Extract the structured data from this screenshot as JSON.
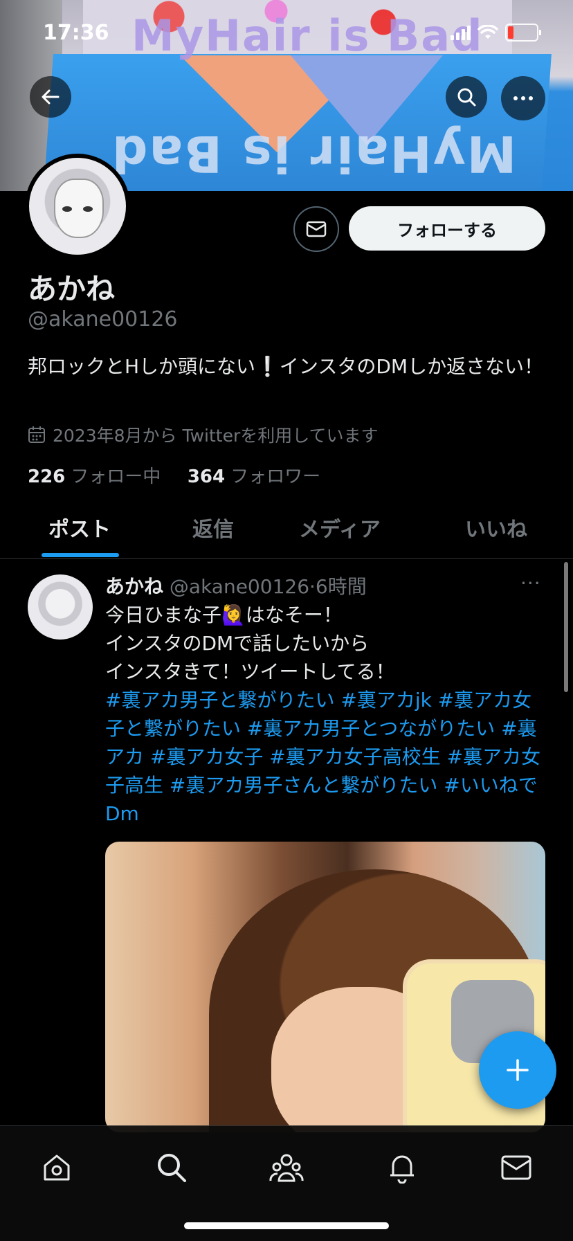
{
  "status_bar": {
    "time": "17:36"
  },
  "banner": {
    "brand_text_top": "MyHair is Bad",
    "brand_text_bottom": "MyHair is Bad"
  },
  "profile": {
    "name": "あかね",
    "handle": "@akane00126",
    "bio": "邦ロックとHしか頭にない❕インスタのDMしか返さない！",
    "joined": "2023年8月から Twitterを利用しています",
    "following_count": "226",
    "following_label": "フォロー中",
    "followers_count": "364",
    "followers_label": "フォロワー",
    "follow_button": "フォローする"
  },
  "tabs": [
    {
      "label": "ポスト",
      "active": true
    },
    {
      "label": "返信",
      "active": false
    },
    {
      "label": "メディア",
      "active": false
    },
    {
      "label": "いいね",
      "active": false
    }
  ],
  "tweet": {
    "name": "あかね",
    "handle": "@akane00126",
    "time": "6時間",
    "line1": "今日ひまな子🙋‍♀️はなそー！",
    "line2": "インスタのDMで話したいから",
    "line3": "インスタきて！ツイートしてる！",
    "hashtags": "#裏アカ男子と繋がりたい #裏アカjk #裏アカ女子と繋がりたい #裏アカ男子とつながりたい #裏アカ #裏アカ女子 #裏アカ女子高校生 #裏アカ女子高生 #裏アカ男子さんと繋がりたい #いいねでDm",
    "more": "···"
  },
  "colors": {
    "accent": "#1d9bf0",
    "background": "#000000",
    "muted": "#71767b"
  },
  "icons": {
    "back": "arrow-left-icon",
    "search": "search-icon",
    "more": "more-horizontal-icon",
    "dm": "mail-icon",
    "calendar": "calendar-icon",
    "compose": "plus-icon",
    "nav": [
      "home-icon",
      "search-icon",
      "communities-icon",
      "bell-icon",
      "mail-icon"
    ]
  }
}
